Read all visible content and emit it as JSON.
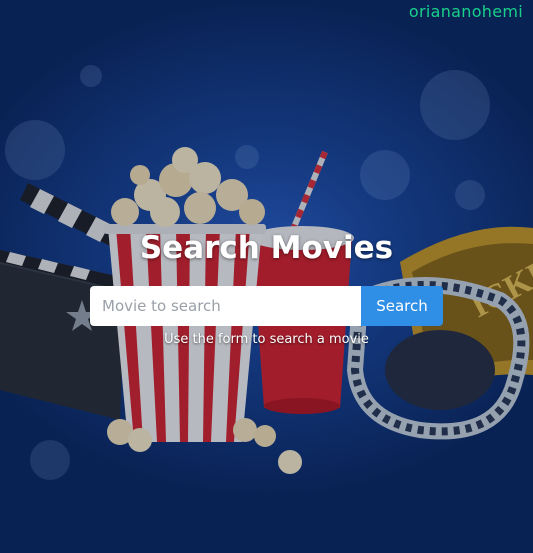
{
  "brand": {
    "name": "oriananohemi"
  },
  "hero": {
    "title": "Search Movies",
    "search_placeholder": "Movie to search",
    "search_value": "",
    "search_button_label": "Search",
    "hint": "Use the form to search a movie"
  },
  "colors": {
    "brand": "#19d18a",
    "button": "#2f8ee6",
    "background": "#1a4597"
  },
  "icons": [
    "clapperboard-icon",
    "popcorn-icon",
    "soda-cup-icon",
    "ticket-icon",
    "film-reel-icon"
  ]
}
